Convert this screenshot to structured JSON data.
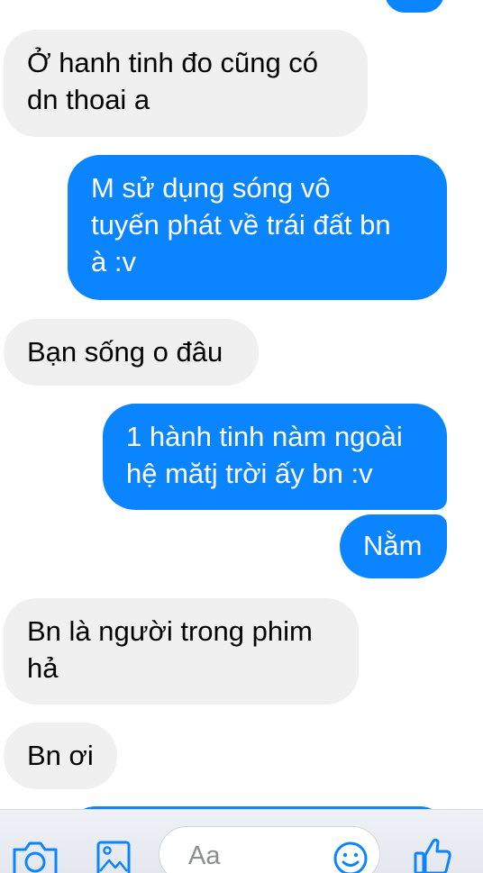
{
  "messages": [
    {
      "side": "in",
      "text": "Ở hanh tinh đo cũng có\ndn thoai a"
    },
    {
      "side": "out",
      "text": "M sử dụng sóng vô\ntuyến phát về trái đất bn\nà :v"
    },
    {
      "side": "in",
      "text": "Bạn sống o đâu"
    },
    {
      "side": "out",
      "text": "1 hành tinh nàm ngoài\nhệ mătj trời ấy bn :v"
    },
    {
      "side": "out",
      "text": "Nằm"
    },
    {
      "side": "in",
      "text": "Bn là người trong phim\nhả"
    },
    {
      "side": "in",
      "text": "Bn ơi"
    }
  ],
  "composer": {
    "placeholder": "Aa",
    "icons": [
      "camera-icon",
      "gallery-icon",
      "emoji-icon",
      "like-icon"
    ]
  },
  "colors": {
    "outgoing_bubble": "#0b84ff",
    "incoming_bubble": "#f1f0f0",
    "icon_blue": "#0b84ff"
  }
}
